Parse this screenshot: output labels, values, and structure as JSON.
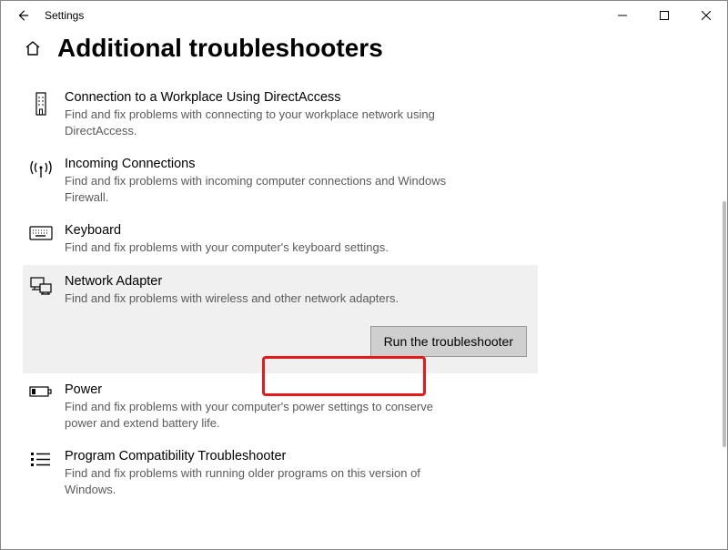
{
  "app": {
    "title": "Settings"
  },
  "page": {
    "title": "Additional troubleshooters"
  },
  "troubleshooters": [
    {
      "id": "directaccess",
      "title": "Connection to a Workplace Using DirectAccess",
      "desc": "Find and fix problems with connecting to your workplace network using DirectAccess."
    },
    {
      "id": "incoming",
      "title": "Incoming Connections",
      "desc": "Find and fix problems with incoming computer connections and Windows Firewall."
    },
    {
      "id": "keyboard",
      "title": "Keyboard",
      "desc": "Find and fix problems with your computer's keyboard settings."
    },
    {
      "id": "network-adapter",
      "title": "Network Adapter",
      "desc": "Find and fix problems with wireless and other network adapters.",
      "selected": true,
      "run_label": "Run the troubleshooter"
    },
    {
      "id": "power",
      "title": "Power",
      "desc": "Find and fix problems with your computer's power settings to conserve power and extend battery life."
    },
    {
      "id": "program-compat",
      "title": "Program Compatibility Troubleshooter",
      "desc": "Find and fix problems with running older programs on this version of Windows."
    }
  ]
}
